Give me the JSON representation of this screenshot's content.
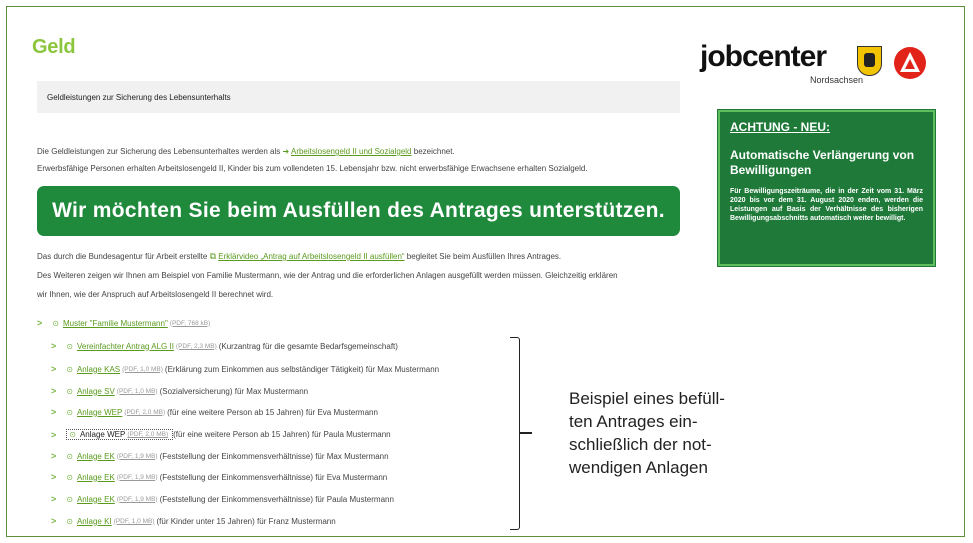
{
  "page": {
    "title": "Geld",
    "subtitle": "Geldleistungen zur Sicherung des Lebensunterhalts"
  },
  "intro": {
    "line1_pre": "Die Geldleistungen zur Sicherung des Lebensunterhaltes werden als",
    "line1_link": "Arbeitslosengeld II und Sozialgeld",
    "line1_post": "bezeichnet.",
    "line2": "Erwerbsfähige Personen erhalten Arbeitslosengeld II, Kinder bis zum vollendeten 15. Lebensjahr bzw. nicht erwerbsfähige Erwachsene erhalten Sozialgeld."
  },
  "banner": {
    "text": "Wir möchten Sie beim Ausfüllen des Antrages unterstützen."
  },
  "video_para": {
    "pre": "Das durch die Bundesagentur für Arbeit erstellte",
    "link": "Erklärvideo „Antrag auf Arbeitslosengeld II ausfüllen“",
    "post": "begleitet Sie beim Ausfüllen Ihres Antrages."
  },
  "example_para": {
    "line1": "Des Weiteren zeigen wir Ihnen am Beispiel von Familie Mustermann, wie der Antrag und die erforderlichen Anlagen ausgefüllt werden müssen. Gleichzeitig erklären",
    "line2": "wir Ihnen, wie der Anspruch auf Arbeitslosengeld II berechnet wird."
  },
  "main_download": {
    "label": "Muster \"Familie Mustermann\"",
    "meta": "(PDF, 768 kB)"
  },
  "downloads": [
    {
      "label": "Vereinfachter Antrag ALG II",
      "meta": "(PDF, 2,3 MB)",
      "desc": "(Kurzantrag für die gesamte Bedarfsgemeinschaft)"
    },
    {
      "label": "Anlage KAS",
      "meta": "(PDF, 1,0 MB)",
      "desc": "(Erklärung zum Einkommen aus selbständiger Tätigkeit) für Max Mustermann"
    },
    {
      "label": "Anlage SV",
      "meta": "(PDF, 1,0 MB)",
      "desc": "(Sozialversicherung) für Max Mustermann"
    },
    {
      "label": "Anlage WEP",
      "meta": "(PDF, 2,0 MB)",
      "desc": "(für eine weitere Person ab 15 Jahren) für Eva Mustermann"
    },
    {
      "label": "Anlage WEP",
      "meta": "(PDF, 2,0 MB)",
      "desc": "(für eine weitere Person ab 15 Jahren) für Paula Mustermann"
    },
    {
      "label": "Anlage EK",
      "meta": "(PDF, 1,9 MB)",
      "desc": "(Feststellung der Einkommensverhältnisse) für Max Mustermann"
    },
    {
      "label": "Anlage EK",
      "meta": "(PDF, 1,9 MB)",
      "desc": "(Feststellung der Einkommensverhältnisse) für Eva Mustermann"
    },
    {
      "label": "Anlage EK",
      "meta": "(PDF, 1,9 MB)",
      "desc": "(Feststellung der Einkommensverhältnisse) für Paula Mustermann"
    },
    {
      "label": "Anlage KI",
      "meta": "(PDF, 1,0 MB)",
      "desc": "(für Kinder unter 15 Jahren) für Franz Mustermann"
    }
  ],
  "annotation": {
    "line1": "Beispiel eines befüll-",
    "line2": "ten Antrages ein-",
    "line3": "schließlich der not-",
    "line4": "wendigen Anlagen"
  },
  "logo": {
    "name": "jobcenter",
    "region": "Nordsachsen"
  },
  "notice": {
    "heading": "ACHTUNG - NEU:",
    "title": "Automatische Verlängerung von Bewilligungen",
    "body": "Für Bewilligungszeiträume, die in der Zeit vom 31. März 2020 bis vor dem 31. August 2020 enden, werden die Leistungen auf Basis der Verhältnisse des bisherigen Bewilligungsabschnitts automatisch weiter bewilligt."
  },
  "icons": {
    "chevron": "chevron-right-icon",
    "download": "download-icon",
    "arrow": "arrow-right-icon",
    "external": "external-link-icon"
  },
  "colors": {
    "accent_green": "#8cc63f",
    "link_green": "#5a9a1e",
    "banner_green": "#1f8a3c",
    "notice_green": "#1f7a3a",
    "logo_red": "#e2231a",
    "crest_yellow": "#f2c300"
  }
}
